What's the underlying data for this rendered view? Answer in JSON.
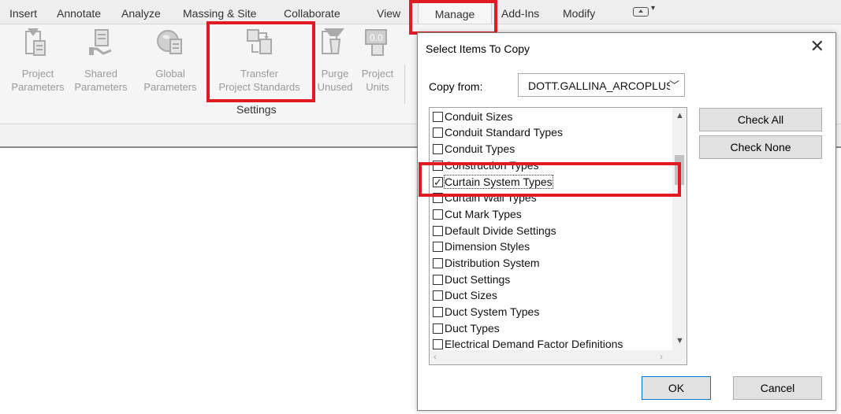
{
  "ribbon_tabs": [
    {
      "label": "Insert"
    },
    {
      "label": "Annotate"
    },
    {
      "label": "Analyze"
    },
    {
      "label": "Massing & Site"
    },
    {
      "label": "Collaborate"
    },
    {
      "label": "View"
    },
    {
      "label": "Manage"
    },
    {
      "label": "Add-Ins"
    },
    {
      "label": "Modify"
    }
  ],
  "active_tab": "Manage",
  "ribbon_buttons": [
    {
      "line1": "Project",
      "line2": "Parameters",
      "icon": "project-parameters-icon"
    },
    {
      "line1": "Shared",
      "line2": "Parameters",
      "icon": "shared-parameters-icon"
    },
    {
      "line1": "Global",
      "line2": "Parameters",
      "icon": "global-parameters-icon"
    },
    {
      "line1": "Transfer",
      "line2": "Project Standards",
      "icon": "transfer-standards-icon"
    },
    {
      "line1": "Purge",
      "line2": "Unused",
      "icon": "purge-icon"
    },
    {
      "line1": "Project",
      "line2": "Units",
      "icon": "units-icon"
    }
  ],
  "panel_label": "Settings",
  "dialog": {
    "title": "Select Items To Copy",
    "copy_from_label": "Copy from:",
    "copy_from_value": "DOTT.GALLINA_ARCOPLUS62",
    "items": [
      {
        "label": "Conduit Sizes",
        "checked": false
      },
      {
        "label": "Conduit Standard Types",
        "checked": false
      },
      {
        "label": "Conduit Types",
        "checked": false
      },
      {
        "label": "Construction Types",
        "checked": false
      },
      {
        "label": "Curtain System Types",
        "checked": true
      },
      {
        "label": "Curtain Wall Types",
        "checked": false
      },
      {
        "label": "Cut Mark Types",
        "checked": false
      },
      {
        "label": "Default Divide Settings",
        "checked": false
      },
      {
        "label": "Dimension Styles",
        "checked": false
      },
      {
        "label": "Distribution System",
        "checked": false
      },
      {
        "label": "Duct Settings",
        "checked": false
      },
      {
        "label": "Duct Sizes",
        "checked": false
      },
      {
        "label": "Duct System Types",
        "checked": false
      },
      {
        "label": "Duct Types",
        "checked": false
      },
      {
        "label": "Electrical Demand Factor Definitions",
        "checked": false
      }
    ],
    "check_all_label": "Check All",
    "check_none_label": "Check None",
    "ok_label": "OK",
    "cancel_label": "Cancel"
  },
  "colors": {
    "highlight": "#e01b24",
    "ribbon_bg": "#f5f5f5"
  }
}
